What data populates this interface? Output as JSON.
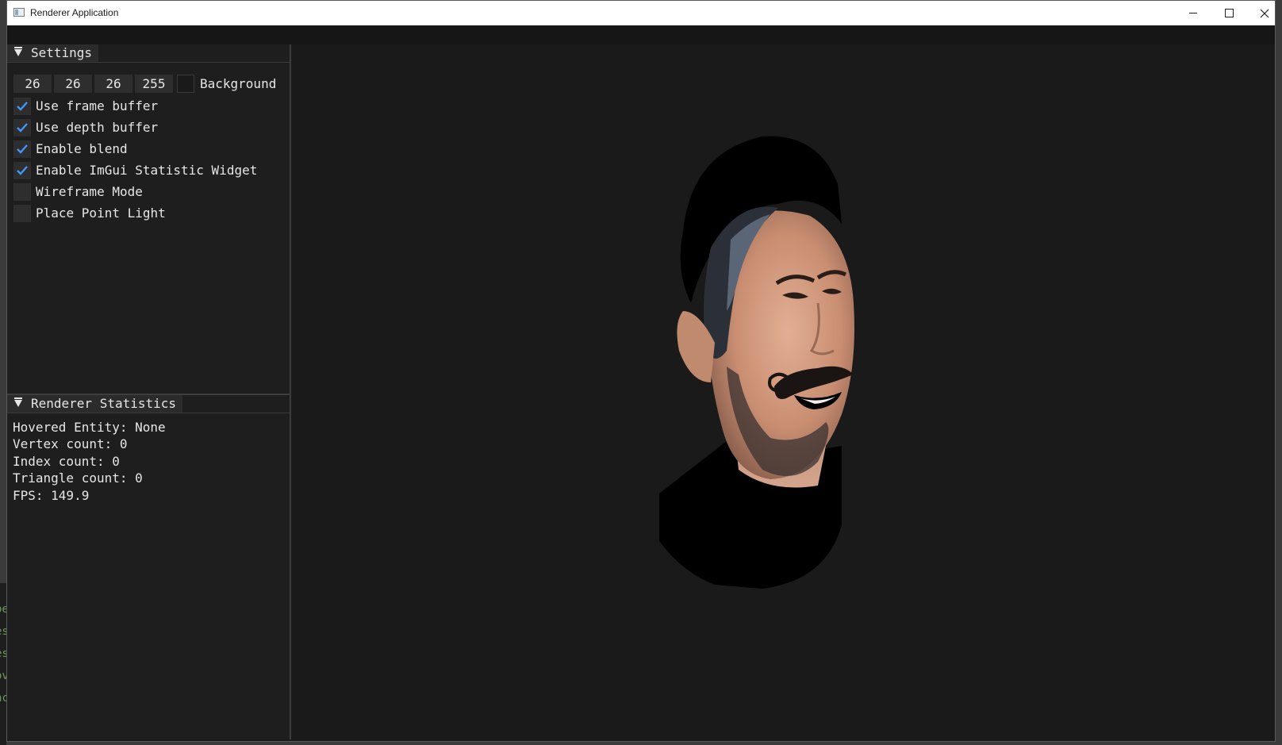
{
  "window": {
    "title": "Renderer Application"
  },
  "background_text": [
    "oe",
    "es",
    "es",
    "ov",
    "nc"
  ],
  "settings": {
    "title": "Settings",
    "background_color": {
      "r": "26",
      "g": "26",
      "b": "26",
      "a": "255",
      "label": "Background",
      "swatch": "#1a1a1a"
    },
    "options": [
      {
        "label": "Use frame buffer",
        "checked": true
      },
      {
        "label": "Use depth buffer",
        "checked": true
      },
      {
        "label": "Enable blend",
        "checked": true
      },
      {
        "label": "Enable ImGui Statistic Widget",
        "checked": true
      },
      {
        "label": "Wireframe Mode",
        "checked": false
      },
      {
        "label": "Place Point Light",
        "checked": false
      }
    ]
  },
  "stats": {
    "title": "Renderer Statistics",
    "lines": [
      "Hovered Entity: None",
      "Vertex count: 0",
      "Index count: 0",
      "Triangle count: 0",
      "FPS: 149.9"
    ]
  },
  "colors": {
    "accent": "#4296fa",
    "panel_bg": "#1e1e1e",
    "viewport_bg": "#1a1a1a"
  },
  "icons": {
    "app": "window-app-icon",
    "minimize": "minimize-icon",
    "maximize": "maximize-icon",
    "close": "close-icon",
    "collapse": "collapse-triangle-icon",
    "check": "checkmark-icon"
  }
}
